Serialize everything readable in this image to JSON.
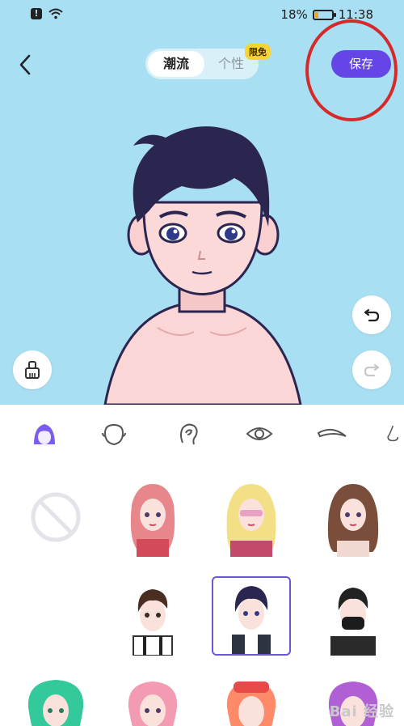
{
  "status_bar": {
    "battery_percent": "18%",
    "time": "11:38",
    "battery_level": 0.18
  },
  "header": {
    "tabs": [
      {
        "label": "潮流",
        "active": true
      },
      {
        "label": "个性",
        "active": false
      }
    ],
    "badge": "限免",
    "save_label": "保存"
  },
  "icons": {
    "back": "chevron-left-icon",
    "eraser": "eraser-icon",
    "undo": "undo-icon",
    "redo": "redo-icon",
    "none": "none-icon"
  },
  "categories": [
    {
      "name": "hair",
      "icon": "hair-icon",
      "active": true
    },
    {
      "name": "face-shape",
      "icon": "face-shape-icon",
      "active": false
    },
    {
      "name": "ear",
      "icon": "ear-icon",
      "active": false
    },
    {
      "name": "eye",
      "icon": "eye-icon",
      "active": false
    },
    {
      "name": "eyebrow",
      "icon": "eyebrow-icon",
      "active": false
    },
    {
      "name": "nose",
      "icon": "nose-icon",
      "active": false
    }
  ],
  "colors": {
    "stage_bg": "#a9dff2",
    "accent": "#6645e6",
    "selected_border": "#6b57d6",
    "highlight": "#d62a2a"
  },
  "watermark": "Bai 经验"
}
